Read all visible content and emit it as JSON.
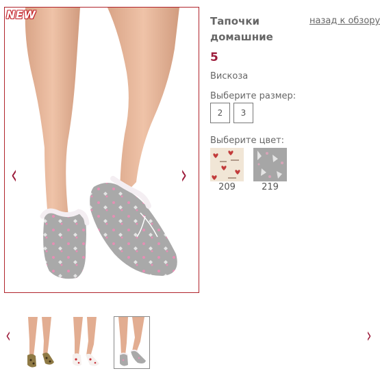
{
  "badge": {
    "text": "NEW"
  },
  "product": {
    "title": "Тапочки домашние",
    "back_link": "назад к обзору",
    "price": "5",
    "material": "Вискоза"
  },
  "sizes": {
    "label": "Выберите размер:",
    "options": [
      "2",
      "3"
    ]
  },
  "colors": {
    "label": "Выберите цвет:",
    "options": [
      {
        "code": "209",
        "pattern": "cream with red hearts",
        "base": "#f1e6d6",
        "accent": "#c23b3b"
      },
      {
        "code": "219",
        "pattern": "grey with cat print",
        "base": "#a6a6a6",
        "accent": "#d8a4b8"
      }
    ]
  },
  "gallery": {
    "prev_icon": "‹",
    "next_icon": "›",
    "thumbnails": [
      {
        "variant": "leopard slippers",
        "active": false
      },
      {
        "variant": "white slippers with red print",
        "active": false
      },
      {
        "variant": "grey slippers with cat print",
        "active": true
      }
    ]
  },
  "theme": {
    "accent": "#9c1b3a",
    "frame_border": "#b0222a",
    "text": "#666666",
    "skin": "#e7b79b",
    "slipper_grey": "#a9a9a9",
    "slipper_pink": "#e58fb4"
  }
}
